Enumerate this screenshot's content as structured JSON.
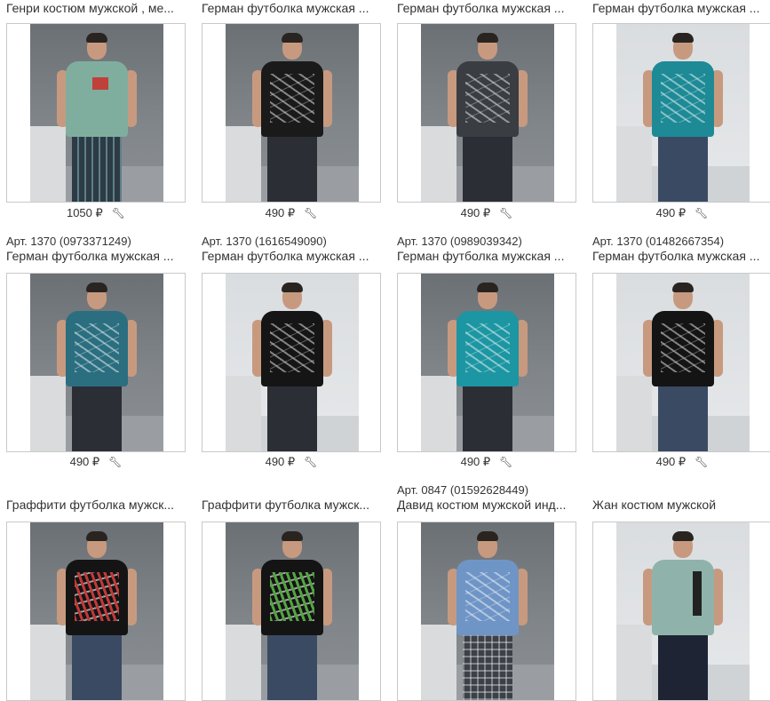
{
  "colors": {
    "text": "#333333",
    "border": "#c9c9c9",
    "background": "#ffffff"
  },
  "products": [
    {
      "article": "",
      "title": "Генри костюм мужской , ме...",
      "price": "1050 ₽",
      "shirt": "#7fae9f",
      "print": "small",
      "pants": "plaid",
      "bg": "dark"
    },
    {
      "article": "",
      "title": "Герман футболка мужская ...",
      "price": "490 ₽",
      "shirt": "#1a1a1a",
      "print": "white",
      "pants": "dark",
      "bg": "dark"
    },
    {
      "article": "",
      "title": "Герман футболка мужская ...",
      "price": "490 ₽",
      "shirt": "#3a3d42",
      "print": "white",
      "pants": "dark",
      "bg": "dark"
    },
    {
      "article": "",
      "title": "Герман футболка мужская ...",
      "price": "490 ₽",
      "shirt": "#1d8a96",
      "print": "white",
      "pants": "jeans",
      "bg": "light"
    },
    {
      "article": "Арт. 1370 (0973371249)",
      "title": "Герман футболка мужская ...",
      "price": "490 ₽",
      "shirt": "#2a6e80",
      "print": "white",
      "pants": "dark",
      "bg": "dark"
    },
    {
      "article": "Арт. 1370 (1616549090)",
      "title": "Герман футболка мужская ...",
      "price": "490 ₽",
      "shirt": "#151515",
      "print": "white",
      "pants": "dark",
      "bg": "light"
    },
    {
      "article": "Арт. 1370 (0989039342)",
      "title": "Герман футболка мужская ...",
      "price": "490 ₽",
      "shirt": "#1c96a2",
      "print": "white",
      "pants": "dark",
      "bg": "dark"
    },
    {
      "article": "Арт. 1370 (01482667354)",
      "title": "Герман футболка мужская ...",
      "price": "490 ₽",
      "shirt": "#141414",
      "print": "white",
      "pants": "jeans",
      "bg": "light"
    },
    {
      "article": "",
      "title": "Граффити футболка мужск...",
      "price": "",
      "shirt": "#141414",
      "print": "graffiti-red",
      "pants": "jeans",
      "bg": "dark"
    },
    {
      "article": "",
      "title": "Граффити футболка мужск...",
      "price": "",
      "shirt": "#141414",
      "print": "graffiti-green",
      "pants": "jeans",
      "bg": "dark"
    },
    {
      "article": "Арт. 0847 (01592628449)",
      "title": "Давид костюм мужской инд...",
      "price": "",
      "shirt": "#6f95c6",
      "print": "white",
      "pants": "check",
      "bg": "dark"
    },
    {
      "article": "",
      "title": "Жан костюм мужской",
      "price": "",
      "shirt": "#8fb3ab",
      "print": "pocket",
      "pants": "navy",
      "bg": "light"
    }
  ],
  "icons": {
    "edit": "wrench-icon"
  }
}
